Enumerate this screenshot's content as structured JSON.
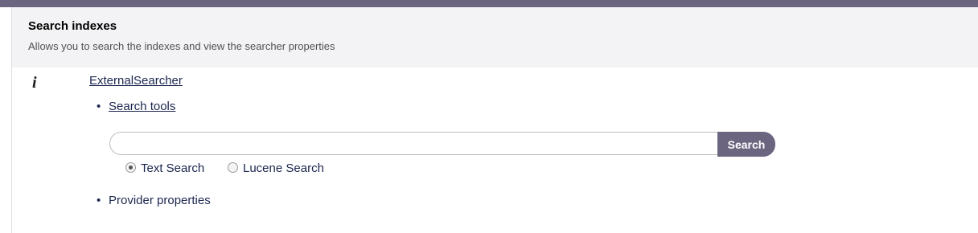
{
  "header": {
    "title": "Search indexes",
    "description": "Allows you to search the indexes and view the searcher properties"
  },
  "info_icon": "info-icon",
  "searcher": {
    "name": "ExternalSearcher",
    "sections": {
      "search_tools_label": "Search tools",
      "provider_properties_label": "Provider properties"
    },
    "search": {
      "value": "",
      "placeholder": "",
      "button_label": "Search"
    },
    "search_types": {
      "options": [
        "Text Search",
        "Lucene Search"
      ],
      "selected": "Text Search"
    }
  },
  "colors": {
    "accent": "#6b6580",
    "header_bg": "#f3f3f5",
    "text": "#1b264f"
  }
}
